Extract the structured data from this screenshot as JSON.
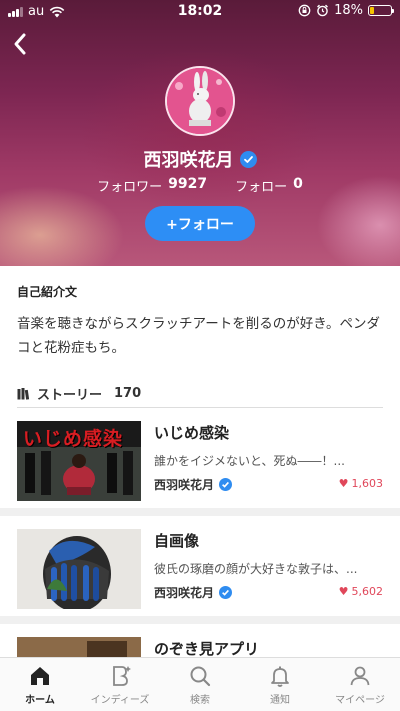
{
  "status_bar": {
    "carrier": "au",
    "time": "18:02",
    "battery": "18%",
    "battery_level": 0.18
  },
  "profile": {
    "name": "西羽咲花月",
    "followers_label": "フォロワー",
    "followers_count": "9927",
    "following_label": "フォロー",
    "following_count": "0",
    "follow_button": "+フォロー"
  },
  "bio": {
    "heading": "自己紹介文",
    "text": "音楽を聴きながらスクラッチアートを削るのが好き。ペンダコと花粉症もち。"
  },
  "stories": {
    "heading": "ストーリー",
    "count": "170",
    "items": [
      {
        "title": "いじめ感染",
        "excerpt": "誰かをイジメないと、死ぬ――！...",
        "author": "西羽咲花月",
        "likes": "1,603",
        "thumb_text": "いじめ感染"
      },
      {
        "title": "自画像",
        "excerpt": "彼氏の琢磨の顔が大好きな敦子は、...",
        "author": "西羽咲花月",
        "likes": "5,602"
      },
      {
        "title": "のぞき見アプリ"
      }
    ]
  },
  "tabs": [
    {
      "label": "ホーム",
      "icon": "home-icon",
      "active": true
    },
    {
      "label": "インディーズ",
      "icon": "indies-icon"
    },
    {
      "label": "検索",
      "icon": "search-icon"
    },
    {
      "label": "通知",
      "icon": "bell-icon"
    },
    {
      "label": "マイページ",
      "icon": "person-icon"
    }
  ],
  "colors": {
    "accent": "#2d8ef5",
    "like": "#e0475a",
    "verified": "#2f8cf0"
  }
}
